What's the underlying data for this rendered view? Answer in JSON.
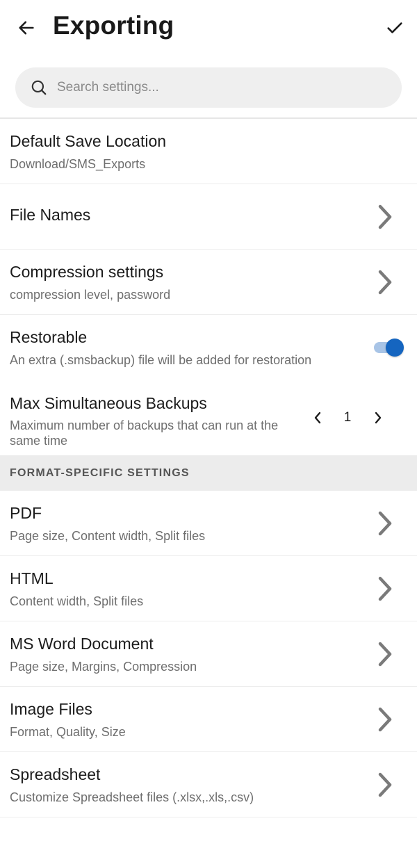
{
  "header": {
    "title": "Exporting",
    "back_icon": "arrow-left-icon",
    "confirm_icon": "checkmark-icon"
  },
  "search": {
    "placeholder": "Search settings...",
    "icon": "search-icon"
  },
  "settings": {
    "default_save_location": {
      "title": "Default Save Location",
      "subtitle": "Download/SMS_Exports"
    },
    "file_names": {
      "title": "File Names"
    },
    "compression": {
      "title": "Compression settings",
      "subtitle": "compression level, password"
    },
    "restorable": {
      "title": "Restorable",
      "subtitle": "An extra (.smsbackup) file will be added for restoration",
      "enabled": true
    },
    "max_backups": {
      "title": "Max Simultaneous Backups",
      "subtitle": "Maximum number of backups that can run at the same time",
      "value": "1"
    }
  },
  "format_section": {
    "label": "FORMAT-SPECIFIC SETTINGS",
    "items": [
      {
        "title": "PDF",
        "subtitle": "Page size, Content width, Split files"
      },
      {
        "title": "HTML",
        "subtitle": "Content width, Split files"
      },
      {
        "title": "MS Word Document",
        "subtitle": "Page size, Margins, Compression"
      },
      {
        "title": "Image Files",
        "subtitle": "Format, Quality, Size"
      },
      {
        "title": "Spreadsheet",
        "subtitle": "Customize Spreadsheet files (.xlsx,.xls,.csv)"
      }
    ]
  },
  "colors": {
    "accent": "#1565c0",
    "toggle_track": "#a8c4e6",
    "section_bg": "#ececec",
    "search_bg": "#efefef"
  }
}
